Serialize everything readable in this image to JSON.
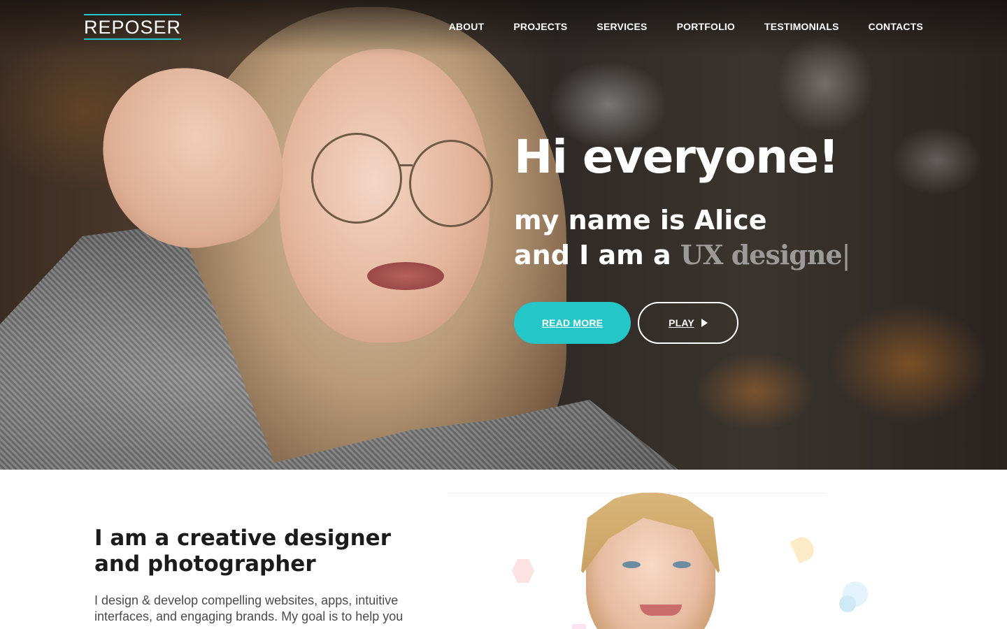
{
  "brand": {
    "logo": "REPOSER",
    "accent_color": "#25c6c7"
  },
  "nav": {
    "items": [
      "ABOUT",
      "PROJECTS",
      "SERVICES",
      "PORTFOLIO",
      "TESTIMONIALS",
      "CONTACTS"
    ]
  },
  "hero": {
    "title": "Hi everyone!",
    "line1": "my name is Alice",
    "line2_prefix": "and I am a ",
    "typed_text": "UX designe",
    "cursor": "|",
    "read_more_label": "READ MORE",
    "play_label": "PLAY",
    "play_icon": "play-icon"
  },
  "about": {
    "title": "I am a creative designer\nand photographer",
    "text": "I design & develop compelling websites, apps, intuitive interfaces, and engaging brands. My goal is to help you"
  }
}
